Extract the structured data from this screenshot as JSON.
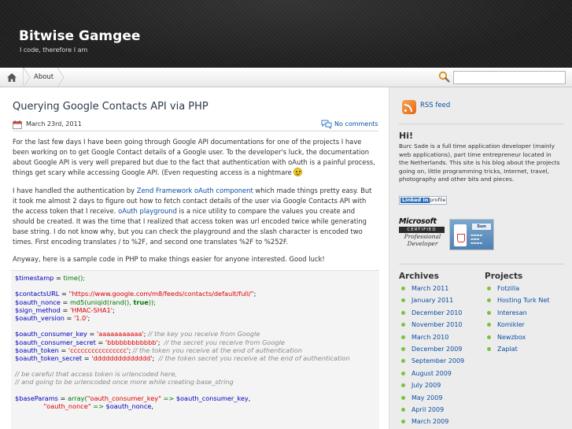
{
  "header": {
    "site_title": "Bitwise Gamgee",
    "tagline": "I code, therefore I am"
  },
  "nav": {
    "home_icon": "home-icon",
    "items": [
      {
        "label": "About"
      }
    ],
    "search_placeholder": ""
  },
  "post": {
    "title": "Querying Google Contacts API via PHP",
    "date": "March 23rd, 2011",
    "comments": "No comments",
    "p1": "For the last few days I have been going through Google API documentations for one of the projects I have been working on to get Google Contact details of a Google user. To the developer's luck, the documentation about Google API is very well prepared but due to the fact that authentication with oAuth is a painful process, things get scary while accessing Google API. (Even requesting access is a nightmare",
    "p2_pre": "I have handled the authentication by ",
    "p2_link1": "Zend Framework oAuth component",
    "p2_mid": " which made things pretty easy. But it took me almost 2 days to figure out how to fetch contact details of the user via Google Contacts API with the access token that I receive. ",
    "p2_link2": "oAuth playground",
    "p2_post": " is a nice utility to compare the values you create and should be created. It was the time that I realized that access token was url encoded twice while generating base string. I do not know why, but you can check the playground and the slash character is encoded two times. First encoding translates / to %2F, and second one translates %2F to %252F.",
    "p3": "Anyway, here is a sample code in PHP to make things easier for anyone interested. Good luck!"
  },
  "code": {
    "l1_var": "$timestamp",
    "l1_eq": " = ",
    "l1_fn": "time",
    "l1_end": "();",
    "l3_var": "$contactsURL",
    "l3_eq": " = ",
    "l3_str": "\"https://www.google.com/m8/feeds/contacts/default/full/\"",
    "l3_end": ";",
    "l4_var": "$oauth_nonce",
    "l4_eq": " = ",
    "l4_fn": "md5",
    "l4_a": "(",
    "l4_fn2": "uniqid",
    "l4_b": "(",
    "l4_fn3": "rand",
    "l4_c": "(), ",
    "l4_kw": "true",
    "l4_end": "));",
    "l5_var": "$sign_method",
    "l5_eq": " = ",
    "l5_str": "'HMAC-SHA1'",
    "l5_end": ";",
    "l6_var": "$oauth_version",
    "l6_eq": " = ",
    "l6_str": "'1.0'",
    "l6_end": ";",
    "l8_var": "$oauth_consumer_key",
    "l8_eq": " = ",
    "l8_str": "'aaaaaaaaaaa'",
    "l8_end": ";",
    "l8_cm": " // the key you receive from Google",
    "l9_var": "$oauth_consumer_secret",
    "l9_eq": " = ",
    "l9_str": "'bbbbbbbbbbbb'",
    "l9_end": ";",
    "l9_cm": "  // the secret you receive from Google",
    "l10_var": "$oauth_token",
    "l10_eq": " = ",
    "l10_str": "'cccccccccccccccc'",
    "l10_end": ";",
    "l10_cm": " // the token you receive at the end of authentication",
    "l11_var": "$oauth_token_secret",
    "l11_eq": " = ",
    "l11_str": "'dddddddddddddd'",
    "l11_end": ";",
    "l11_cm": "  // the token secret you receive at the end of authentication",
    "l13_cm": "// be careful that access token is urlencoded here,",
    "l14_cm": "// and going to be urlencoded once more while creating base_string",
    "l16_var": "$baseParams",
    "l16_eq": " = ",
    "l16_fn": "array",
    "l16_a": "(",
    "l16_str": "\"oauth_consumer_key\"",
    "l16_arrow": " => ",
    "l16_var2": "$oauth_consumer_key",
    "l16_end": ",",
    "l17_indent": "              ",
    "l17_str": "\"oauth_nonce\"",
    "l17_arrow": " => ",
    "l17_var2": "$oauth_nonce",
    "l17_end": ","
  },
  "sidebar": {
    "rss_label": "RSS feed",
    "hi_title": "Hi!",
    "hi_text": "Burc Sade is a full time application developer (mainly web applications), part time entrepreneur located in the Netherlands. This site is his blog about the projects going on, little programming tricks, Internet, travel, photography and other bits and pieces.",
    "linkedin_a": "Linked in",
    "linkedin_b": "profile",
    "mcp_brand": "Microsoft",
    "mcp_cert": "CERTIFIED",
    "mcp_line1": "Professional",
    "mcp_line2": "Developer",
    "scjp_sun": "Sun",
    "archives_title": "Archives",
    "archives": [
      "March 2011",
      "January 2011",
      "December 2010",
      "November 2010",
      "March 2010",
      "December 2009",
      "September 2009",
      "August 2009",
      "July 2009",
      "May 2009",
      "April 2009",
      "March 2009"
    ],
    "projects_title": "Projects",
    "projects": [
      "Fotzilla",
      "Hosting Turk Net",
      "Interesan",
      "Komikler",
      "Newzbox",
      "Zaplat"
    ]
  },
  "colors": {
    "header_bg": "#1e1e1e",
    "link": "#0b4fa3",
    "bullet": "#7ec13e",
    "sidebar_bg": "#ececec"
  }
}
